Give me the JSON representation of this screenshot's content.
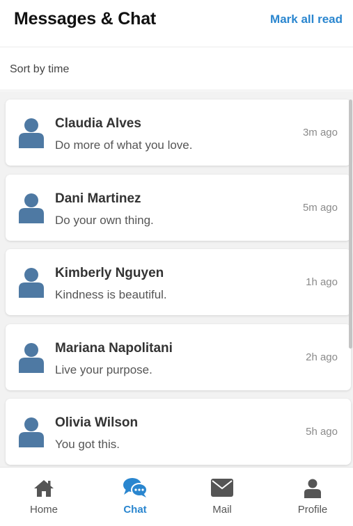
{
  "header": {
    "title": "Messages & Chat",
    "mark_all_read": "Mark all read"
  },
  "sort": {
    "label": "Sort by time"
  },
  "messages": [
    {
      "name": "Claudia Alves",
      "preview": "Do more of what you love.",
      "time": "3m ago"
    },
    {
      "name": "Dani Martinez",
      "preview": "Do your own thing.",
      "time": "5m ago"
    },
    {
      "name": "Kimberly Nguyen",
      "preview": "Kindness is beautiful.",
      "time": "1h ago"
    },
    {
      "name": "Mariana Napolitani",
      "preview": "Live your purpose.",
      "time": "2h ago"
    },
    {
      "name": "Olivia Wilson",
      "preview": "You got this.",
      "time": "5h ago"
    }
  ],
  "tabs": [
    {
      "label": "Home",
      "icon": "home-icon"
    },
    {
      "label": "Chat",
      "icon": "chat-bubbles-icon",
      "active": true
    },
    {
      "label": "Mail",
      "icon": "mail-icon"
    },
    {
      "label": "Profile",
      "icon": "profile-icon"
    }
  ],
  "colors": {
    "accent": "#2a86cf",
    "avatar": "#4e79a3",
    "icon_gray": "#555555",
    "list_background": "#f2f2f2"
  }
}
